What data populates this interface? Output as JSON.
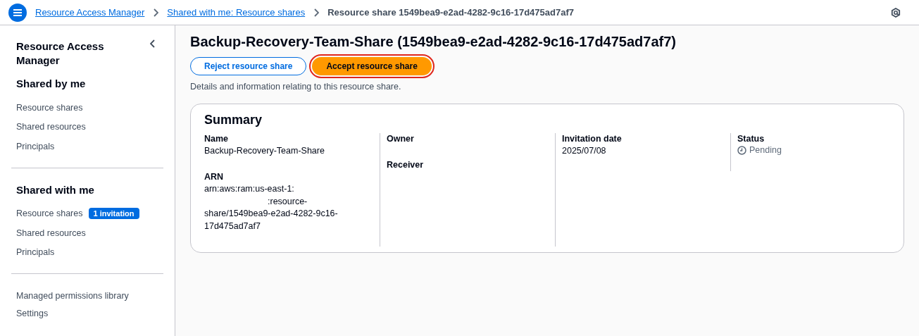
{
  "breadcrumbs": [
    {
      "label": "Resource Access Manager",
      "link": true
    },
    {
      "label": "Shared with me: Resource shares",
      "link": true
    },
    {
      "label": "Resource share 1549bea9-e2ad-4282-9c16-17d475ad7af7",
      "link": false
    }
  ],
  "sidebar": {
    "title": "Resource Access Manager",
    "sections": [
      {
        "heading": "Shared by me",
        "items": [
          {
            "label": "Resource shares"
          },
          {
            "label": "Shared resources"
          },
          {
            "label": "Principals"
          }
        ]
      },
      {
        "heading": "Shared with me",
        "items": [
          {
            "label": "Resource shares",
            "badge": "1 invitation"
          },
          {
            "label": "Shared resources"
          },
          {
            "label": "Principals"
          }
        ]
      },
      {
        "items": [
          {
            "label": "Managed permissions library"
          },
          {
            "label": "Settings"
          }
        ]
      }
    ]
  },
  "page": {
    "title": "Backup-Recovery-Team-Share (1549bea9-e2ad-4282-9c16-17d475ad7af7)",
    "buttons": [
      {
        "label": "Reject resource share",
        "kind": "secondary",
        "highlighted": false
      },
      {
        "label": "Accept resource share",
        "kind": "primary",
        "highlighted": true
      }
    ],
    "description": "Details and information relating to this resource share."
  },
  "summary": {
    "title": "Summary",
    "columns": [
      [
        {
          "label": "Name",
          "value": "Backup-Recovery-Team-Share",
          "kind": "text"
        },
        {
          "label": "ARN",
          "kind": "redacted",
          "value_before": "arn:aws:ram:us-east-1:",
          "value_after": ":resource-share/1549bea9-e2ad-4282-9c16-17d475ad7af7"
        }
      ],
      [
        {
          "label": "Owner",
          "kind": "text"
        },
        {
          "label": "Receiver",
          "kind": "text"
        }
      ],
      [
        {
          "label": "Invitation date",
          "value": "2025/07/08",
          "kind": "text"
        }
      ],
      [
        {
          "label": "Status",
          "value": "Pending",
          "kind": "status"
        }
      ]
    ]
  }
}
